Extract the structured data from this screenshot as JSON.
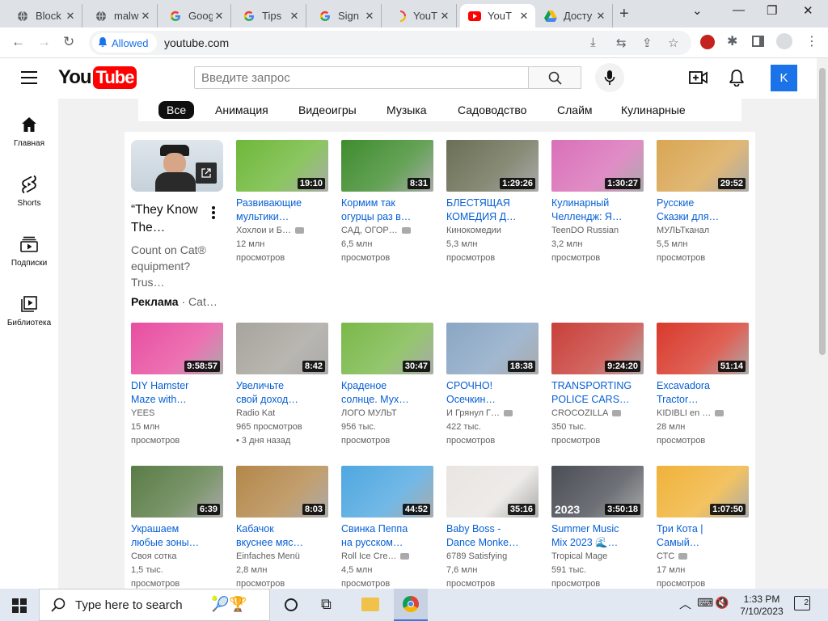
{
  "browser": {
    "tabs": [
      {
        "title": "Block",
        "icon": "globe-icon",
        "active": false
      },
      {
        "title": "malw",
        "icon": "globe-icon",
        "active": false
      },
      {
        "title": "Goog",
        "icon": "google-icon",
        "active": false
      },
      {
        "title": "Tips",
        "icon": "google-icon",
        "active": false
      },
      {
        "title": "Sign",
        "icon": "google-icon",
        "active": false
      },
      {
        "title": "YouT",
        "icon": "loading-icon",
        "active": false
      },
      {
        "title": "YouT",
        "icon": "youtube-icon",
        "active": true
      },
      {
        "title": "Досту",
        "icon": "drive-icon",
        "active": false
      }
    ],
    "site_permission": "Allowed",
    "url": "youtube.com"
  },
  "youtube": {
    "search_placeholder": "Введите запрос",
    "avatar_letter": "K",
    "logo_you": "You",
    "logo_tube": "Tube",
    "guide": [
      {
        "label": "Главная",
        "icon": "home-icon"
      },
      {
        "label": "Shorts",
        "icon": "shorts-icon"
      },
      {
        "label": "Подписки",
        "icon": "subscriptions-icon"
      },
      {
        "label": "Библиотека",
        "icon": "library-icon"
      }
    ],
    "chips": [
      "Все",
      "Анимация",
      "Видеоигры",
      "Музыка",
      "Садоводство",
      "Слайм",
      "Кулинарные"
    ],
    "ad": {
      "title_l1": "“They Know",
      "title_l2": "The…",
      "desc_l1": "Count on Cat®",
      "desc_l2": "equipment? Trus…",
      "badge": "Реклама",
      "sponsor": "Cat…"
    },
    "videos": [
      {
        "t1": "Развивающие",
        "t2": "мультики…",
        "channel": "Хохлои и Б…",
        "verified": true,
        "m1": "12 млн",
        "m2": "просмотров",
        "duration": "19:10",
        "bg": "#6fb83a"
      },
      {
        "t1": "Кормим так",
        "t2": "огурцы раз в…",
        "channel": "САД, ОГОР…",
        "verified": true,
        "m1": "6,5 млн",
        "m2": "просмотров",
        "duration": "8:31",
        "bg": "#3f8c2e"
      },
      {
        "t1": "БЛЕСТЯЩАЯ",
        "t2": "КОМЕДИЯ Д…",
        "channel": "Кинокомедии",
        "verified": false,
        "m1": "5,3 млн",
        "m2": "просмотров",
        "duration": "1:29:26",
        "bg": "#6b6f55"
      },
      {
        "t1": "Кулинарный",
        "t2": "Челлендж: Я…",
        "channel": "TeenDO Russian",
        "verified": false,
        "m1": "3,2 млн",
        "m2": "просмотров",
        "duration": "1:30:27",
        "bg": "#d970b8"
      },
      {
        "t1": "Русские",
        "t2": "Сказки для…",
        "channel": "МУЛЬТканал",
        "verified": false,
        "m1": "5,5 млн",
        "m2": "просмотров",
        "duration": "29:52",
        "bg": "#d9a653"
      },
      {
        "t1": "DIY Hamster",
        "t2": "Maze with…",
        "channel": "YEES",
        "verified": false,
        "m1": "15 млн",
        "m2": "просмотров",
        "duration": "9:58:57",
        "bg": "#e84ea0"
      },
      {
        "t1": "Увеличьте",
        "t2": "свой доход…",
        "channel": "Radio Kat",
        "verified": false,
        "m1": "965 просмотров",
        "m2": "• 3 дня назад",
        "duration": "8:42",
        "bg": "#a7a49d"
      },
      {
        "t1": "Краденое",
        "t2": "солнце. Мух…",
        "channel": "ЛОГО МУЛЬТ",
        "verified": false,
        "m1": "956 тыс.",
        "m2": "просмотров",
        "duration": "30:47",
        "bg": "#7ab84a"
      },
      {
        "t1": "СРОЧНО!",
        "t2": "Осечкин…",
        "channel": "И Грянул Г…",
        "verified": true,
        "m1": "422 тыс.",
        "m2": "просмотров",
        "duration": "18:38",
        "bg": "#8aa6c4"
      },
      {
        "t1": "TRANSPORTING",
        "t2": "POLICE CARS…",
        "channel": "CROCOZILLA",
        "verified": true,
        "m1": "350 тыс.",
        "m2": "просмотров",
        "duration": "9:24:20",
        "bg": "#c8403a"
      },
      {
        "t1": "Excavadora",
        "t2": "Tractor…",
        "channel": "KIDIBLI en …",
        "verified": true,
        "m1": "28 млн",
        "m2": "просмотров",
        "duration": "51:14",
        "bg": "#d83a2c"
      },
      {
        "t1": "Украшаем",
        "t2": "любые зоны…",
        "channel": "Своя сотка",
        "verified": false,
        "m1": "1,5 тыс.",
        "m2": "просмотров",
        "duration": "6:39",
        "bg": "#5a7c46"
      },
      {
        "t1": "Кабачок",
        "t2": "вкуснее мяс…",
        "channel": "Einfaches Menü",
        "verified": false,
        "m1": "2,8 млн",
        "m2": "просмотров",
        "duration": "8:03",
        "bg": "#b3874a"
      },
      {
        "t1": "Свинка Пеппа",
        "t2": "на русском…",
        "channel": "Roll Ice Cre…",
        "verified": true,
        "m1": "4,5 млн",
        "m2": "просмотров",
        "duration": "44:52",
        "bg": "#4fa7e0"
      },
      {
        "t1": "Baby Boss -",
        "t2": "Dance Monke…",
        "channel": "6789 Satisfying",
        "verified": false,
        "m1": "7,6 млн",
        "m2": "просмотров",
        "duration": "35:16",
        "bg": "#e9e6e2"
      },
      {
        "t1": "Summer Music",
        "t2": "Mix 2023 🌊…",
        "channel": "Tropical Mage",
        "verified": false,
        "m1": "591 тыс.",
        "m2": "просмотров",
        "duration": "3:50:18",
        "bg": "#4a4e55",
        "overlay": "2023"
      },
      {
        "t1": "Три Кота |",
        "t2": "Самый…",
        "channel": "СТС",
        "verified": true,
        "m1": "17 млн",
        "m2": "просмотров",
        "duration": "1:07:50",
        "bg": "#f0b33a"
      }
    ]
  },
  "taskbar": {
    "search_placeholder": "Type here to search",
    "time": "1:33 PM",
    "date": "7/10/2023",
    "notifications": "2"
  }
}
